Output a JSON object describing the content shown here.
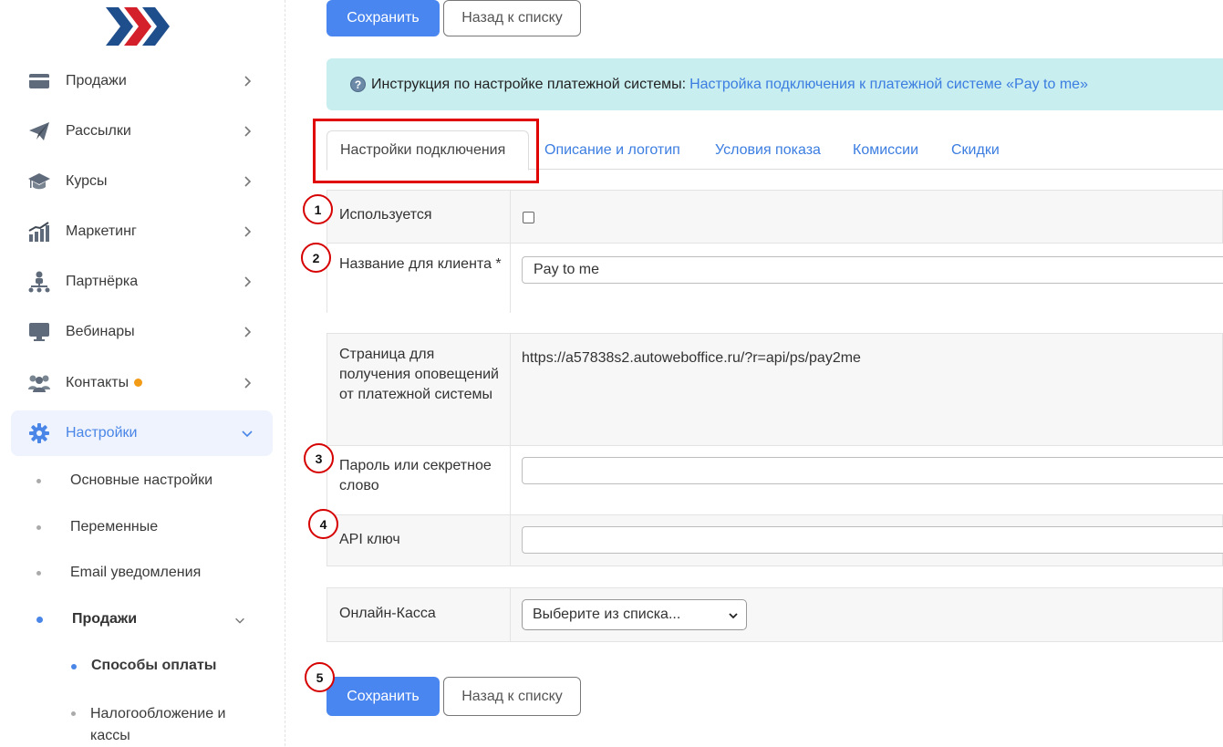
{
  "sidebar": {
    "items": [
      {
        "label": "Продажи",
        "icon": "wallet-icon"
      },
      {
        "label": "Рассылки",
        "icon": "paper-plane-icon"
      },
      {
        "label": "Курсы",
        "icon": "graduation-cap-icon"
      },
      {
        "label": "Маркетинг",
        "icon": "chart-bar-icon"
      },
      {
        "label": "Партнёрка",
        "icon": "network-icon"
      },
      {
        "label": "Вебинары",
        "icon": "monitor-icon"
      },
      {
        "label": "Контакты",
        "icon": "users-icon"
      },
      {
        "label": "Настройки",
        "icon": "gear-icon"
      }
    ],
    "settings_sub": [
      {
        "label": "Основные настройки"
      },
      {
        "label": "Переменные"
      },
      {
        "label": "Email уведомления"
      },
      {
        "label": "Продажи"
      }
    ],
    "sales_sub": [
      {
        "label": "Способы оплаты"
      },
      {
        "label": "Налогообложение и кассы"
      }
    ]
  },
  "toolbar": {
    "save_label": "Сохранить",
    "back_label": "Назад к списку"
  },
  "info": {
    "icon": "?",
    "text": "Инструкция по настройке платежной системы:",
    "link": "Настройка подключения к платежной системе «Pay to me»"
  },
  "tabs": [
    {
      "label": "Настройки подключения"
    },
    {
      "label": "Описание и логотип"
    },
    {
      "label": "Условия показа"
    },
    {
      "label": "Комиссии"
    },
    {
      "label": "Скидки"
    }
  ],
  "form": {
    "used_label": "Используется",
    "client_name_label": "Название для клиента *",
    "client_name_value": "Pay to me",
    "notify_page_label": "Страница для получения оповещений от платежной системы",
    "notify_page_value": "https://a57838s2.autoweboffice.ru/?r=api/ps/pay2me",
    "password_label": "Пароль или секретное слово",
    "api_key_label": "API ключ",
    "cashbox_label": "Онлайн-Касса",
    "cashbox_select": "Выберите из списка..."
  },
  "annotations": [
    "1",
    "2",
    "3",
    "4",
    "5"
  ],
  "colors": {
    "accent": "#4a86f0",
    "highlight": "#e00000",
    "info_bg": "#c9eef0"
  }
}
